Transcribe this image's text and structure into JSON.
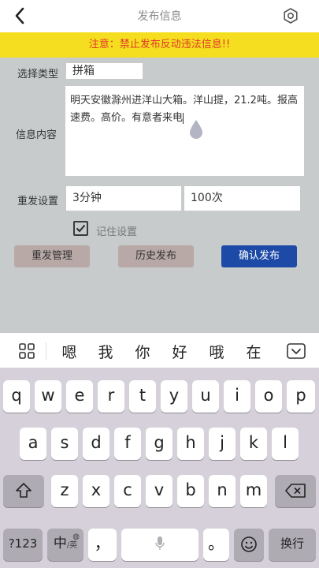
{
  "nav": {
    "title": "发布信息"
  },
  "warning": "注意：禁止发布反动违法信息!!",
  "form": {
    "type_label": "选择类型",
    "type_value": "拼箱",
    "content_label": "信息内容",
    "content_value": "明天安徽滁州进洋山大箱。洋山提，21.2吨。报高速费。高价。有意者来电",
    "repeat_label": "重发设置",
    "repeat_interval": "3分钟",
    "repeat_count": "100次",
    "remember_label": "记住设置",
    "remember_checked": true
  },
  "buttons": {
    "manage": "重发管理",
    "history": "历史发布",
    "publish": "确认发布"
  },
  "candidates": [
    "嗯",
    "我",
    "你",
    "好",
    "哦",
    "在"
  ],
  "keyboard": {
    "row1": [
      "q",
      "w",
      "e",
      "r",
      "t",
      "y",
      "u",
      "i",
      "o",
      "p"
    ],
    "row2": [
      "a",
      "s",
      "d",
      "f",
      "g",
      "h",
      "j",
      "k",
      "l"
    ],
    "row3": [
      "z",
      "x",
      "c",
      "v",
      "b",
      "n",
      "m"
    ],
    "num_key": "?123",
    "lang_key": "中",
    "lang_sub": "/英",
    "comma_key": "，",
    "period_key": "。",
    "enter_key": "换行"
  },
  "colors": {
    "warning_bg": "#f5de1f",
    "warning_text": "#e23a28",
    "publish_button": "#1d4aa6"
  }
}
